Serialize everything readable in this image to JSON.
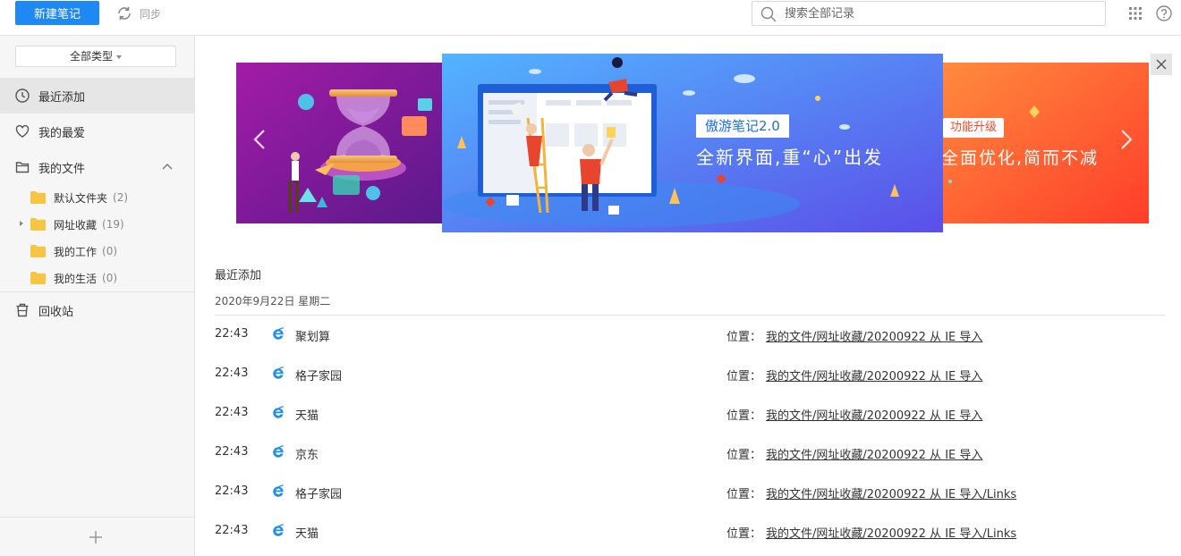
{
  "toolbar": {
    "new_note_label": "新建笔记",
    "sync_label": "同步",
    "search_placeholder": "搜索全部记录"
  },
  "sidebar": {
    "type_filter": "全部类型",
    "items": [
      {
        "label": "最近添加",
        "icon": "clock-icon",
        "active": true
      },
      {
        "label": "我的最爱",
        "icon": "heart-icon"
      },
      {
        "label": "我的文件",
        "icon": "folder-outline-icon",
        "expanded": true
      },
      {
        "label": "回收站",
        "icon": "trash-icon"
      }
    ],
    "folders": [
      {
        "label": "默认文件夹",
        "count": "(2)"
      },
      {
        "label": "网址收藏",
        "count": "(19)",
        "has_children": true
      },
      {
        "label": "我的工作",
        "count": "(0)"
      },
      {
        "label": "我的生活",
        "count": "(0)"
      }
    ]
  },
  "banner": {
    "center_title": "傲游笔记2.0",
    "center_subtitle": "全新界面,重“心”出发",
    "right_tag": "功能升级",
    "right_subtitle": "全面优化,简而不减"
  },
  "main": {
    "section_title": "最近添加",
    "date_header": "2020年9月22日   星期二",
    "location_label": "位置：",
    "rows": [
      {
        "time": "22:43",
        "title": "聚划算",
        "location": "我的文件/网址收藏/20200922 从 IE 导入"
      },
      {
        "time": "22:43",
        "title": "格子家园",
        "location": "我的文件/网址收藏/20200922 从 IE 导入"
      },
      {
        "time": "22:43",
        "title": "天猫",
        "location": "我的文件/网址收藏/20200922 从 IE 导入"
      },
      {
        "time": "22:43",
        "title": "京东",
        "location": "我的文件/网址收藏/20200922 从 IE 导入"
      },
      {
        "time": "22:43",
        "title": "格子家园",
        "location": "我的文件/网址收藏/20200922 从 IE 导入/Links"
      },
      {
        "time": "22:43",
        "title": "天猫",
        "location": "我的文件/网址收藏/20200922 从 IE 导入/Links"
      }
    ]
  },
  "colors": {
    "accent": "#1e88f5",
    "folder": "#f7c544",
    "ie_blue": "#1f8fe8"
  }
}
